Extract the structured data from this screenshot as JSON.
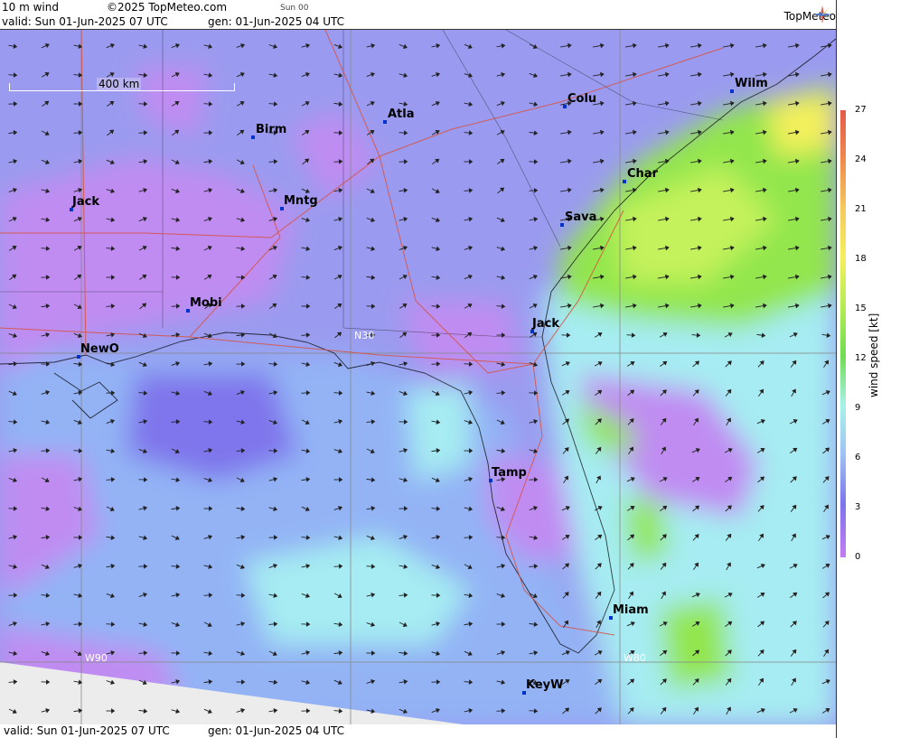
{
  "header": {
    "title": "10 m wind",
    "copyright": "©2025 TopMeteo.com",
    "tab": "Sun 00",
    "valid": "valid:  Sun  01-Jun-2025  07 UTC",
    "gen": "gen: 01-Jun-2025 04 UTC",
    "logo": "TopMeteo"
  },
  "footer": {
    "valid": "valid:  Sun  01-Jun-2025  07 UTC",
    "gen": "gen: 01-Jun-2025 04 UTC"
  },
  "scale": {
    "label": "400 km"
  },
  "gridlabels": {
    "n30": "N30",
    "w90": "W90",
    "w80": "W80"
  },
  "cities": [
    {
      "name": "Atla"
    },
    {
      "name": "Colu"
    },
    {
      "name": "Wilm"
    },
    {
      "name": "Birm"
    },
    {
      "name": "Char"
    },
    {
      "name": "Jack"
    },
    {
      "name": "Mntg"
    },
    {
      "name": "Sava"
    },
    {
      "name": "Mobi"
    },
    {
      "name": "Jack"
    },
    {
      "name": "NewO"
    },
    {
      "name": "Tamp"
    },
    {
      "name": "Miam"
    },
    {
      "name": "KeyW"
    }
  ],
  "legend": {
    "title": "wind speed [kt]",
    "ticks": [
      "27",
      "24",
      "21",
      "18",
      "15",
      "12",
      "9",
      "6",
      "3",
      "0"
    ],
    "colors": {
      "high": "#e55a4a",
      "mid": "#b4ec52",
      "low": "#7c74ec",
      "zero": "#c47cf2"
    }
  }
}
